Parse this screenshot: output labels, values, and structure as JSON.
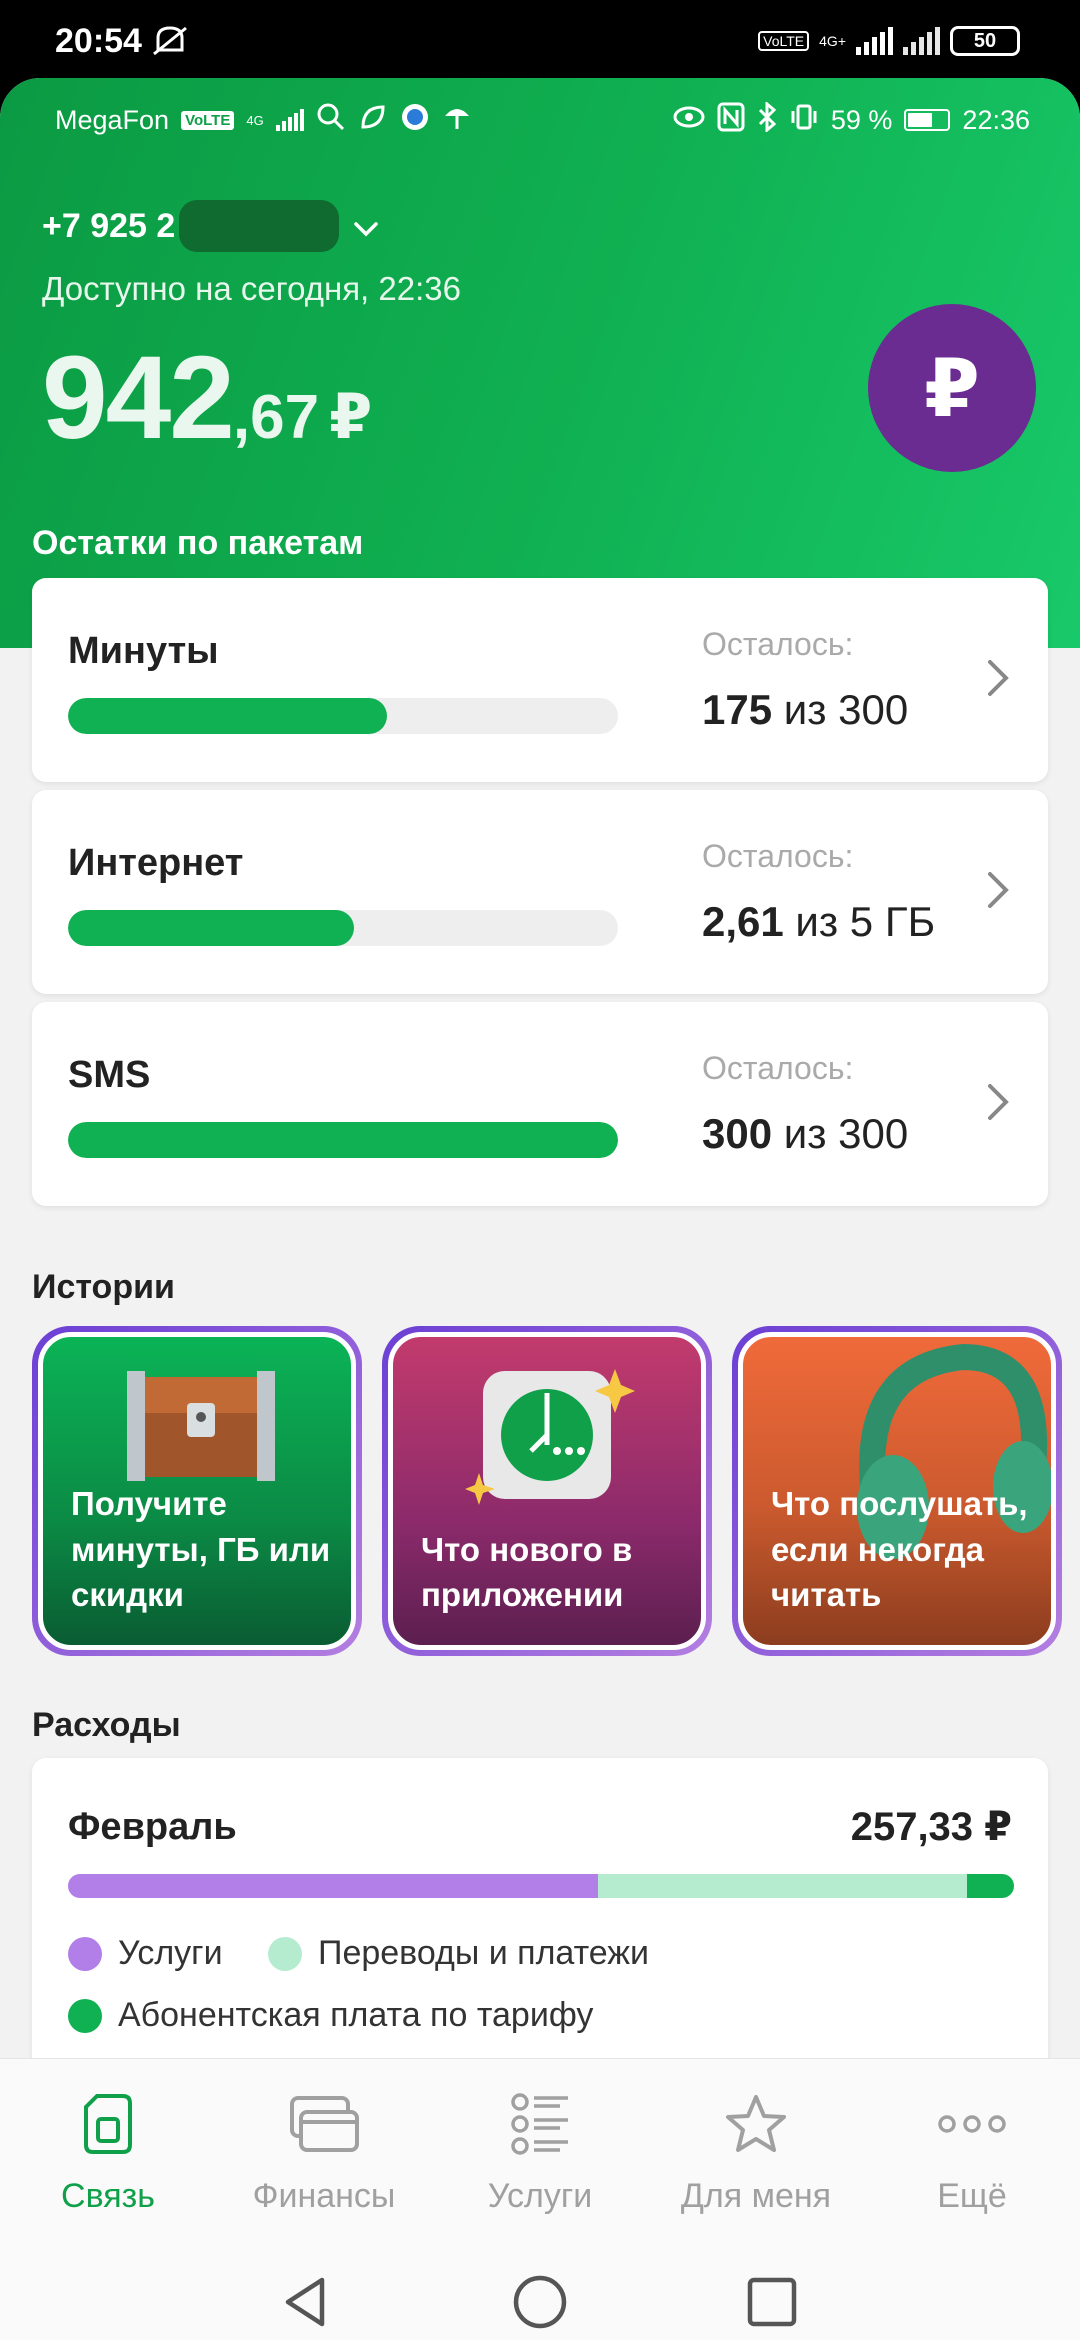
{
  "outer_status": {
    "time": "20:54",
    "network": "4G+",
    "volte": "VoLTE",
    "battery": "50"
  },
  "inner_status": {
    "carrier": "MegaFon",
    "volte": "VoLTE",
    "network": "4G",
    "battery_pct": "59 %",
    "time": "22:36"
  },
  "account": {
    "phone_visible": "+7 925 2",
    "available_label": "Доступно на сегодня, 22:36",
    "balance_int": "942",
    "balance_frac": ",67",
    "currency": "₽",
    "topup_icon": "₽"
  },
  "packages": {
    "title": "Остатки по пакетам",
    "items": [
      {
        "name": "Минуты",
        "left_label": "Осталось:",
        "remaining": "175",
        "of_text": " из 300",
        "fraction": 0.58
      },
      {
        "name": "Интернет",
        "left_label": "Осталось:",
        "remaining": "2,61",
        "of_text": " из 5 ГБ",
        "fraction": 0.52
      },
      {
        "name": "SMS",
        "left_label": "Осталось:",
        "remaining": "300",
        "of_text": " из 300",
        "fraction": 1.0
      }
    ]
  },
  "stories": {
    "title": "Истории",
    "items": [
      {
        "text": "Получите минуты, ГБ или скидки",
        "icon": "treasure-chest-icon"
      },
      {
        "text": "Что нового в приложении",
        "icon": "megafon-app-icon"
      },
      {
        "text": "Что послушать, если некогда читать",
        "icon": "headphones-icon"
      }
    ]
  },
  "expenses": {
    "title": "Расходы",
    "month": "Февраль",
    "total": "257,33 ₽",
    "segments": [
      {
        "name": "Услуги",
        "fraction": 0.56,
        "color": "#b27ee8"
      },
      {
        "name": "Переводы и платежи",
        "fraction": 0.39,
        "color": "#b5ecd0"
      },
      {
        "name": "Абонентская плата по тарифу",
        "fraction": 0.05,
        "color": "#10b152"
      }
    ]
  },
  "nav": {
    "items": [
      {
        "label": "Связь",
        "icon": "sim-card-icon",
        "active": true
      },
      {
        "label": "Финансы",
        "icon": "cards-icon",
        "active": false
      },
      {
        "label": "Услуги",
        "icon": "services-list-icon",
        "active": false
      },
      {
        "label": "Для меня",
        "icon": "star-icon",
        "active": false
      },
      {
        "label": "Ещё",
        "icon": "more-dots-icon",
        "active": false
      }
    ]
  },
  "colors": {
    "brand_green": "#10b152",
    "brand_purple": "#6a2c91",
    "active_nav": "#10a04a"
  }
}
